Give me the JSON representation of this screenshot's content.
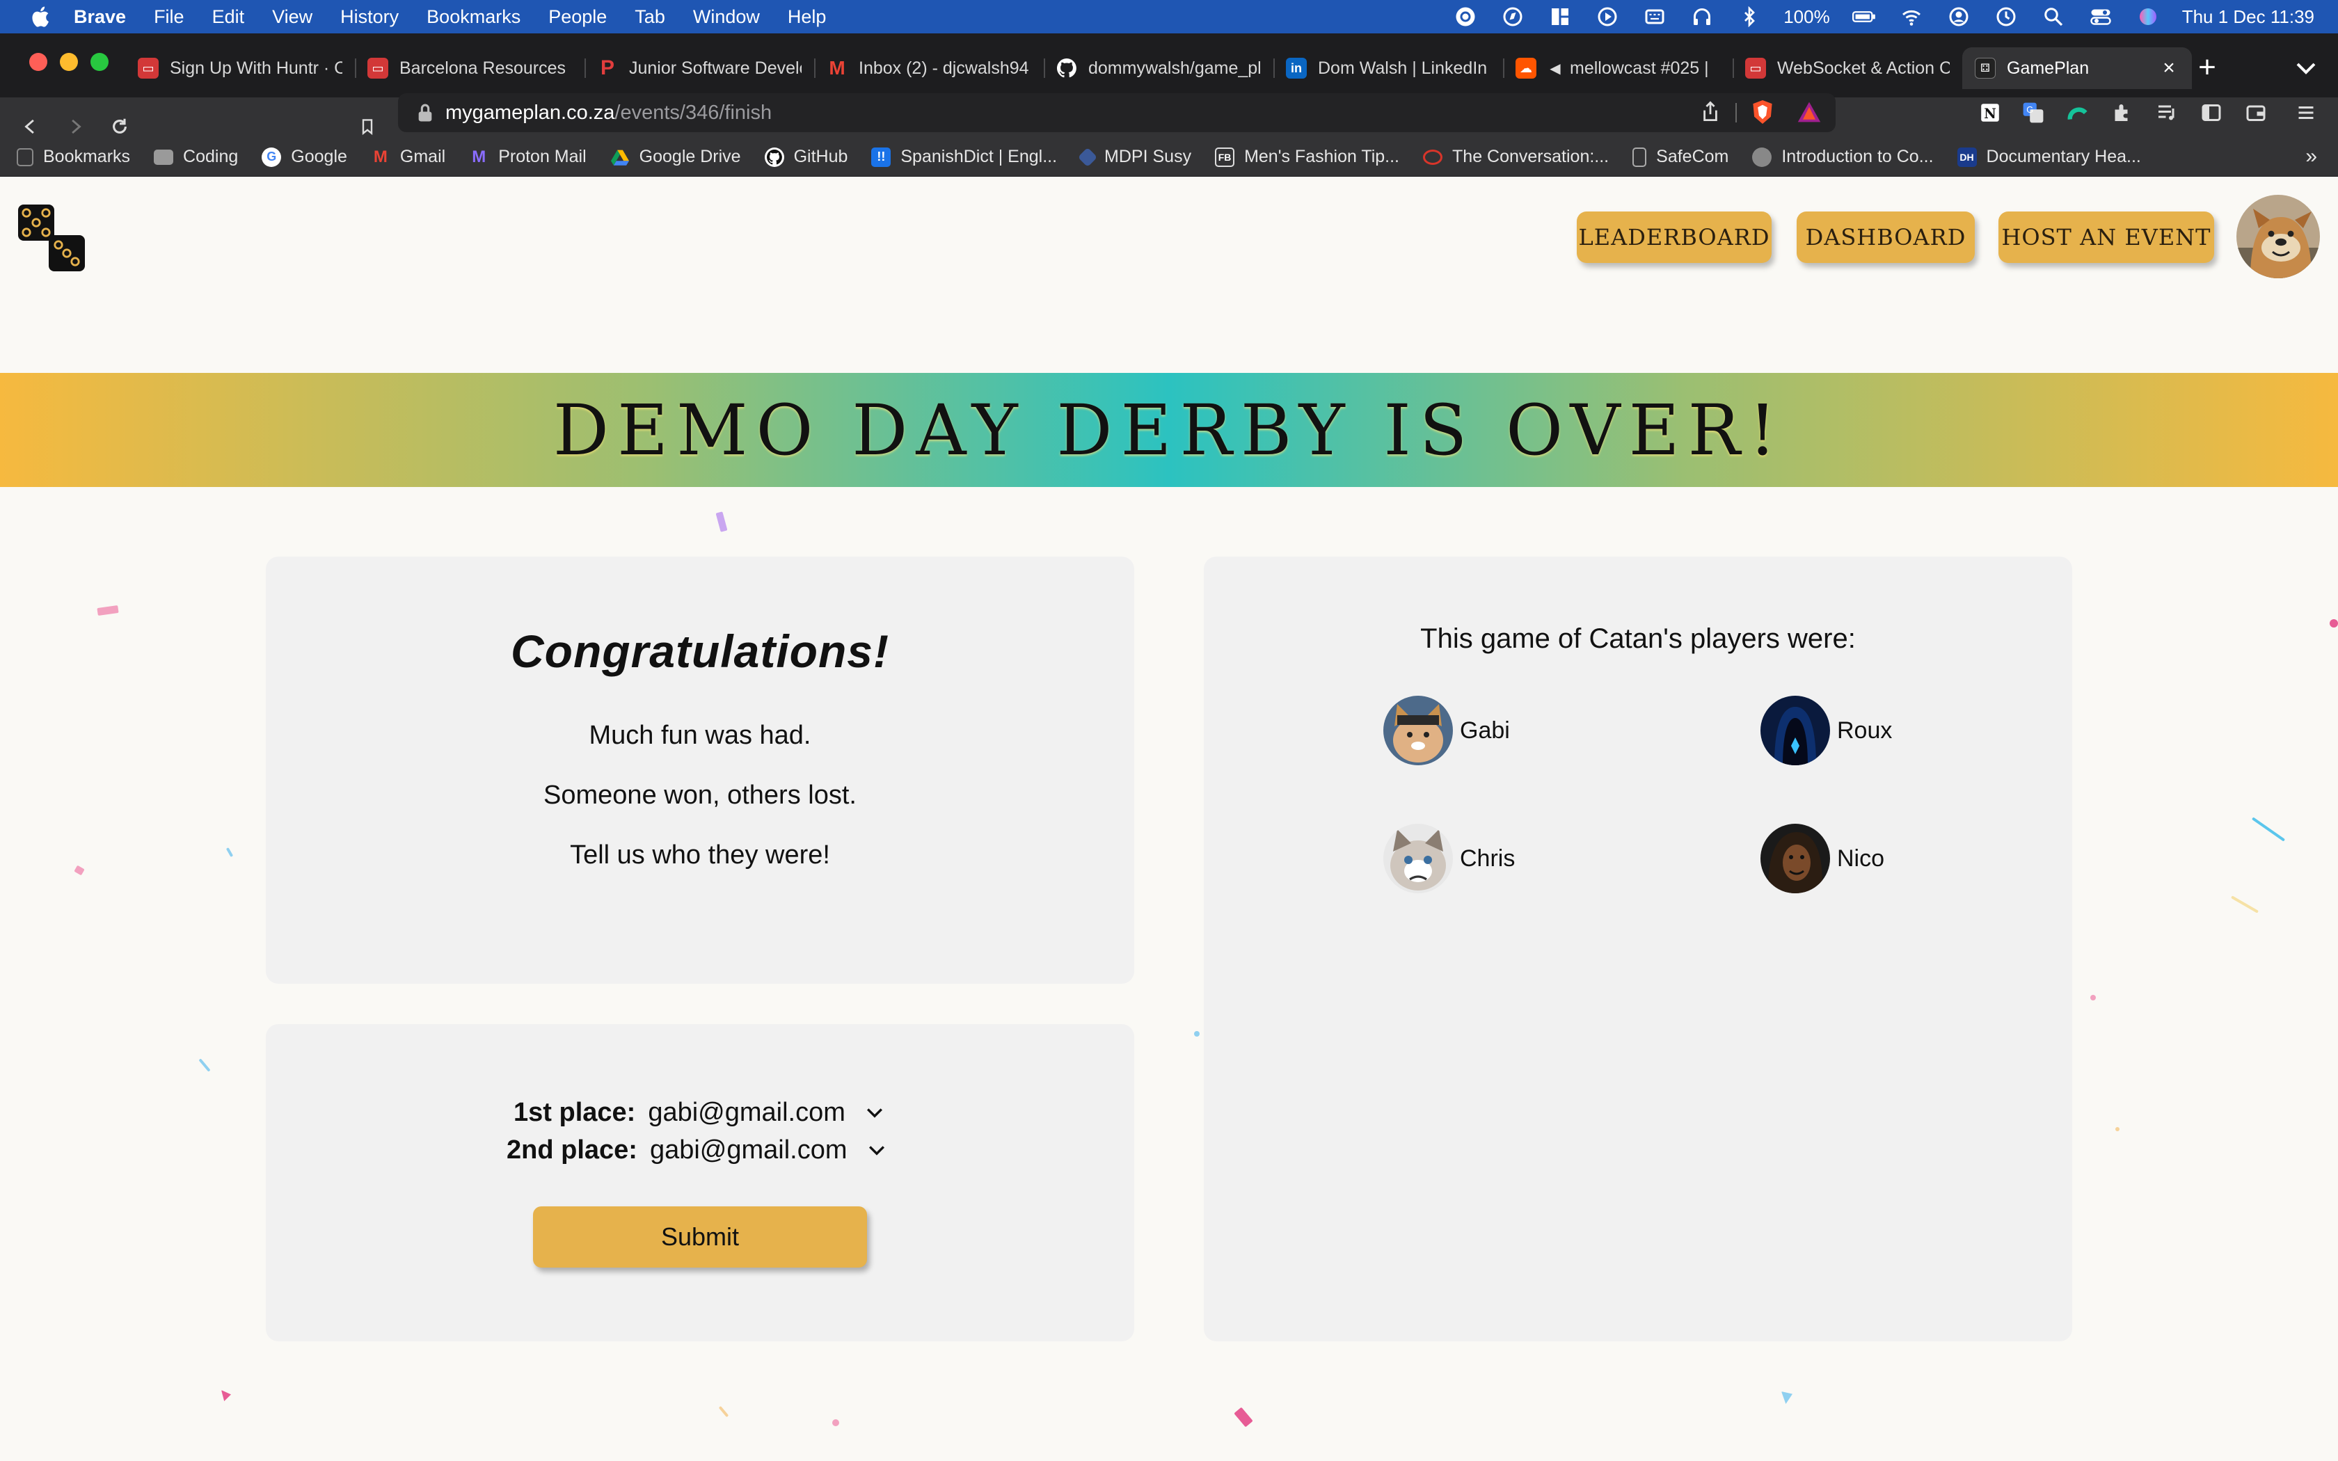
{
  "menubar": {
    "app": "Brave",
    "items": [
      "File",
      "Edit",
      "View",
      "History",
      "Bookmarks",
      "People",
      "Tab",
      "Window",
      "Help"
    ],
    "battery": "100%",
    "datetime": "Thu 1 Dec  11:39"
  },
  "tabs": [
    {
      "title": "Sign Up With Huntr · C",
      "color": "#d23838"
    },
    {
      "title": "Barcelona Resources",
      "color": "#d23838"
    },
    {
      "title": "Junior Software Develc",
      "color": "#e23d3d"
    },
    {
      "title": "Inbox (2) - djcwalsh94",
      "color": "#ffffff"
    },
    {
      "title": "dommywalsh/game_pl",
      "color": "#ffffff"
    },
    {
      "title": "Dom Walsh | LinkedIn",
      "color": "#0a66c2"
    },
    {
      "title": "mellowcast #025 |",
      "color": "#ff5500"
    },
    {
      "title": "WebSocket & Action C",
      "color": "#d23838"
    },
    {
      "title": "GamePlan",
      "color": "#222222"
    }
  ],
  "address": {
    "host": "mygameplan.co.za",
    "path": "/events/346/finish"
  },
  "bookmarks": [
    {
      "label": "Bookmarks",
      "icon": "bookmarks-icon",
      "color": "#666666"
    },
    {
      "label": "Coding",
      "icon": "folder-icon",
      "color": "#9a9a9a"
    },
    {
      "label": "Google",
      "icon": "google-icon",
      "color": "#ffffff"
    },
    {
      "label": "Gmail",
      "icon": "gmail-icon",
      "color": "#ffffff"
    },
    {
      "label": "Proton Mail",
      "icon": "proton-icon",
      "color": "#6d4aff"
    },
    {
      "label": "Google Drive",
      "icon": "drive-icon",
      "color": "#ffffff"
    },
    {
      "label": "GitHub",
      "icon": "github-icon",
      "color": "#ffffff"
    },
    {
      "label": "SpanishDict | Engl...",
      "icon": "spanishdict-icon",
      "color": "#1a73e8"
    },
    {
      "label": "MDPI Susy",
      "icon": "mdpi-icon",
      "color": "#3b5998"
    },
    {
      "label": "Men's Fashion Tip...",
      "icon": "fashion-icon",
      "color": "#222222"
    },
    {
      "label": "The Conversation:...",
      "icon": "conversation-icon",
      "color": "#d8352a"
    },
    {
      "label": "SafeCom",
      "icon": "safecom-icon",
      "color": "#888888"
    },
    {
      "label": "Introduction to Co...",
      "icon": "globe-icon",
      "color": "#888888"
    },
    {
      "label": "Documentary Hea...",
      "icon": "documentary-icon",
      "color": "#1a3b8c"
    }
  ],
  "nav": {
    "leaderboard": "LEADERBOARD",
    "dashboard": "DASHBOARD",
    "host": "HOST AN EVENT"
  },
  "banner": "DEMO DAY DERBY IS OVER!",
  "congrats": {
    "title": "Congratulations!",
    "line1": "Much fun was had.",
    "line2": "Someone won, others lost.",
    "line3": "Tell us who they were!"
  },
  "results": {
    "first_label": "1st place:",
    "first_value": "gabi@gmail.com",
    "second_label": "2nd place:",
    "second_value": "gabi@gmail.com",
    "submit": "Submit"
  },
  "players": {
    "title": "This game of Catan's players were:",
    "list": [
      "Gabi",
      "Roux",
      "Chris",
      "Nico"
    ]
  },
  "colors": {
    "accent": "#e6b24c",
    "banner_center": "#2cc2c0",
    "banner_edge": "#f6b93f",
    "menubar": "#1f56b3"
  }
}
